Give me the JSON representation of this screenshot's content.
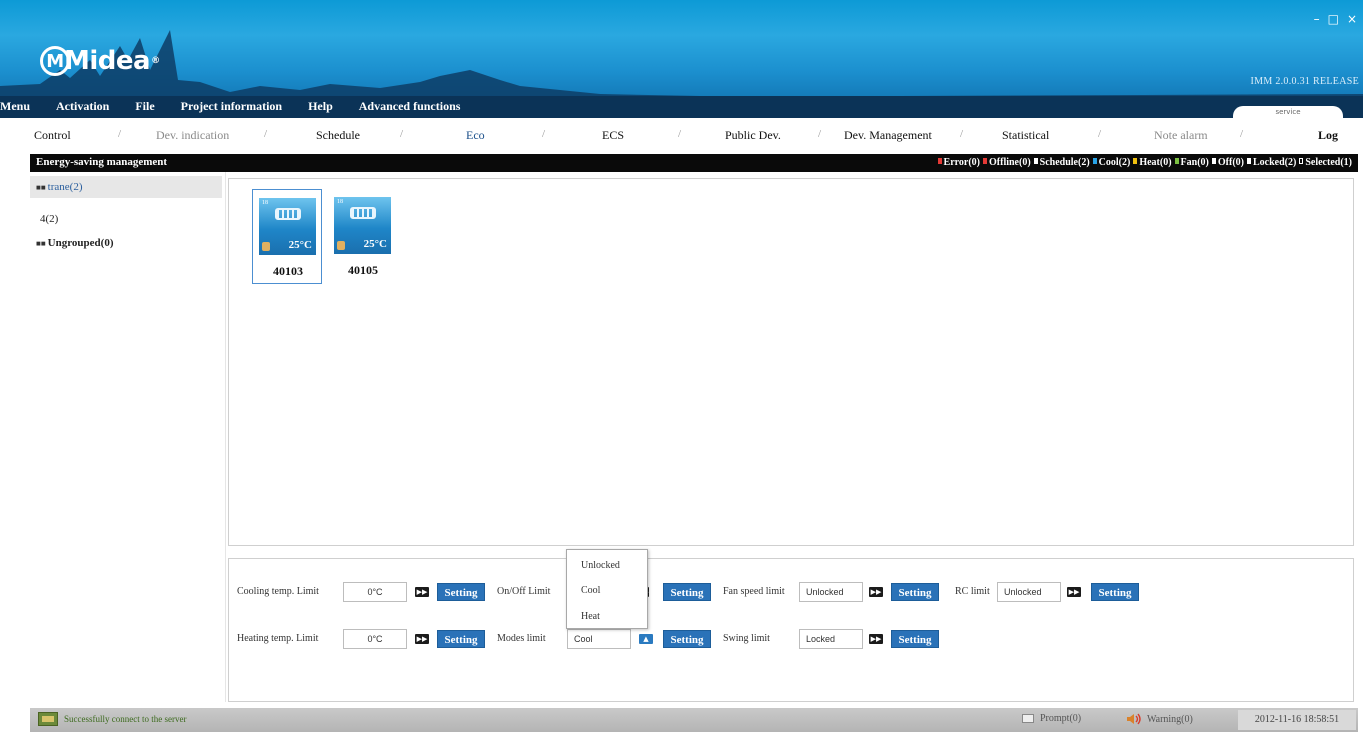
{
  "app": {
    "logo_text": "Midea",
    "version": "IMM 2.0.0.31 RELEASE",
    "service_tab": "service"
  },
  "window_controls": [
    "–",
    "□",
    "×"
  ],
  "menu": [
    "Menu",
    "Activation",
    "File",
    "Project information",
    "Help",
    "Advanced functions"
  ],
  "tabs": [
    "Control",
    "Dev. indication",
    "Schedule",
    "Eco",
    "ECS",
    "Public Dev.",
    "Dev. Management",
    "Statistical",
    "Note alarm",
    "Log"
  ],
  "panel": {
    "title": "Energy-saving management",
    "legend": {
      "error": "Error(0)",
      "offline": "Offline(0)",
      "schedule": "Schedule(2)",
      "cool": "Cool(2)",
      "heat": "Heat(0)",
      "fan": "Fan(0)",
      "off": "Off(0)",
      "locked": "Locked(2)",
      "selected": "Selected(1)"
    }
  },
  "tree": {
    "items": [
      "trane(2)",
      "4(2)",
      "Ungrouped(0)"
    ]
  },
  "devices": [
    {
      "id": "40103",
      "temp": "25°C",
      "badge": "18"
    },
    {
      "id": "40105",
      "temp": "25°C",
      "badge": "18"
    }
  ],
  "settings": {
    "cooling_label": "Cooling temp. Limit",
    "cooling_value": "0°C",
    "heating_label": "Heating temp. Limit",
    "heating_value": "0°C",
    "onoff_label": "On/Off Limit",
    "modes_label": "Modes limit",
    "modes_value": "Cool",
    "fanspeed_label": "Fan speed limit",
    "fanspeed_value": "Unlocked",
    "swing_label": "Swing limit",
    "swing_value": "Locked",
    "rc_label": "RC limit",
    "rc_value": "Unlocked",
    "setting_button": "Setting"
  },
  "modes_dropdown": [
    "Unlocked",
    "Cool",
    "Heat"
  ],
  "status": {
    "message": "Successfully connect to the server",
    "prompt": "Prompt(0)",
    "warning": "Warning(0)",
    "datetime": "2012-11-16 18:58:51"
  },
  "colors": {
    "header_blue": "#1c90cf",
    "button_blue": "#2a72b8",
    "legend_error": "#e53935",
    "legend_offline": "#e53935",
    "legend_cool": "#29a3e6",
    "legend_heat": "#f2c20f",
    "legend_fan": "#7cc142"
  }
}
